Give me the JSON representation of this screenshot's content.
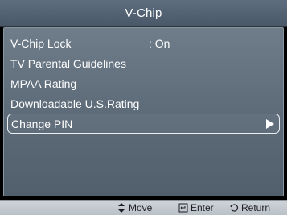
{
  "title": "V-Chip",
  "menu": {
    "items": [
      {
        "label": "V-Chip Lock",
        "value": ": On"
      },
      {
        "label": "TV Parental Guidelines",
        "value": ""
      },
      {
        "label": "MPAA Rating",
        "value": ""
      },
      {
        "label": "Downloadable U.S.Rating",
        "value": ""
      },
      {
        "label": "Change PIN",
        "value": "",
        "selected": true
      }
    ]
  },
  "footer": {
    "move_label": "Move",
    "enter_label": "Enter",
    "return_label": "Return",
    "move_icon": "up-down-arrow-icon",
    "enter_icon": "enter-icon",
    "return_icon": "return-icon"
  }
}
